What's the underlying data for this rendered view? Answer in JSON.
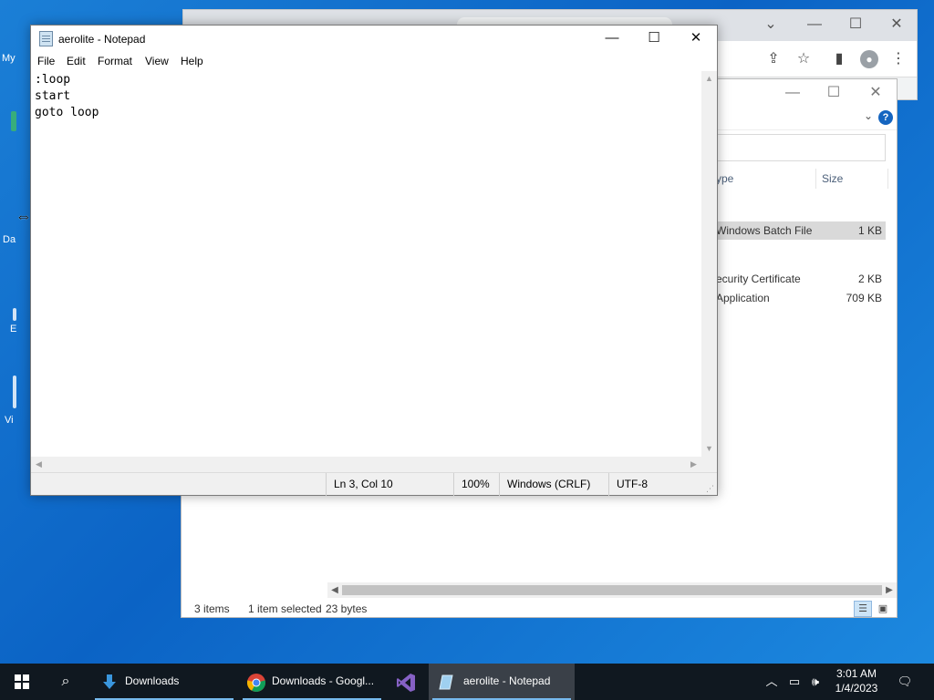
{
  "desktop": {
    "icons": [
      {
        "label": "My"
      },
      {
        "label": "Da"
      },
      {
        "label": "E"
      },
      {
        "label": "Vi"
      }
    ]
  },
  "chrome": {
    "minimize": "⌄",
    "close": "✕"
  },
  "explorer": {
    "columns": {
      "type": "ype",
      "size": "Size"
    },
    "rows": [
      {
        "type": "Windows Batch File",
        "size": "1 KB",
        "selected": true
      },
      {
        "type": "ecurity Certificate",
        "size": "2 KB",
        "selected": false
      },
      {
        "type": "Application",
        "size": "709 KB",
        "selected": false
      }
    ],
    "status": {
      "items": "3 items",
      "selected": "1 item selected",
      "bytes": "23 bytes"
    }
  },
  "notepad": {
    "title": "aerolite - Notepad",
    "menu": [
      "File",
      "Edit",
      "Format",
      "View",
      "Help"
    ],
    "content": ":loop\nstart\ngoto loop",
    "status": {
      "position": "Ln 3, Col 10",
      "zoom": "100%",
      "line_ending": "Windows (CRLF)",
      "encoding": "UTF-8"
    }
  },
  "taskbar": {
    "items": [
      {
        "label": "Downloads",
        "icon": "download-arrow-icon"
      },
      {
        "label": "Downloads - Googl...",
        "icon": "chrome-icon"
      },
      {
        "label": "",
        "icon": "visual-studio-icon"
      },
      {
        "label": "aerolite - Notepad",
        "icon": "notepad-icon"
      }
    ],
    "clock": {
      "time": "3:01 AM",
      "date": "1/4/2023"
    }
  },
  "colors": {
    "desktop": "#0b63c5",
    "taskbar": "#101820",
    "selection": "#d9d9d9",
    "accent": "#76b9ed"
  }
}
